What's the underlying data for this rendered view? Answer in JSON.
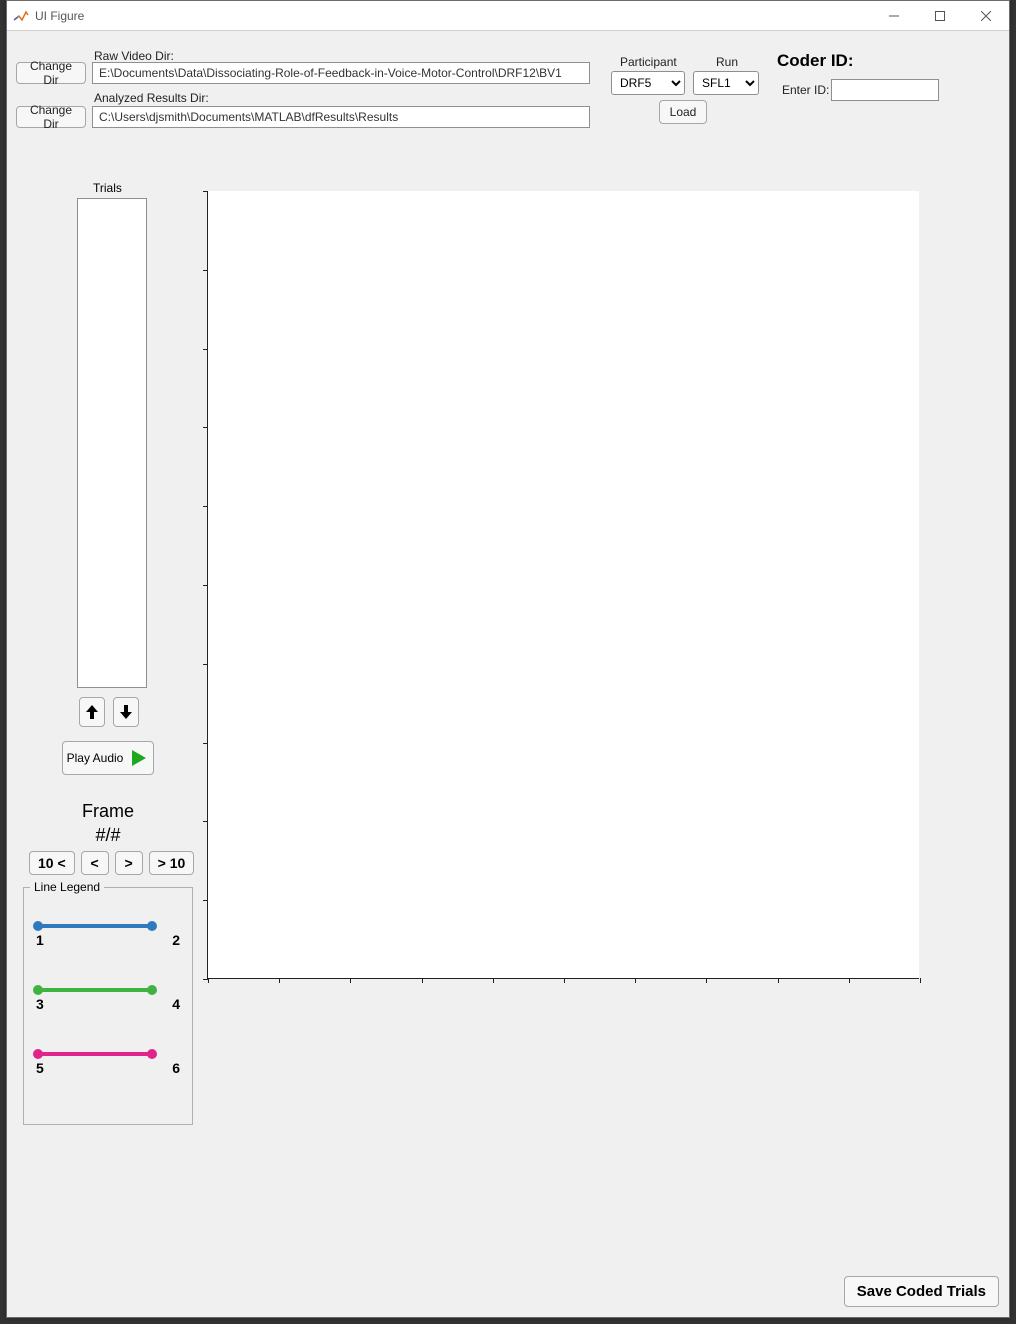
{
  "window": {
    "title": "UI Figure"
  },
  "dirs": {
    "raw_label": "Raw Video Dir:",
    "raw_value": "E:\\Documents\\Data\\Dissociating-Role-of-Feedback-in-Voice-Motor-Control\\DRF12\\BV1",
    "analyzed_label": "Analyzed Results Dir:",
    "analyzed_value": "C:\\Users\\djsmith\\Documents\\MATLAB\\dfResults\\Results",
    "change_dir_label": "Change Dir"
  },
  "participant": {
    "label": "Participant",
    "value": "DRF5"
  },
  "run": {
    "label": "Run",
    "value": "SFL1"
  },
  "load_label": "Load",
  "coder": {
    "title": "Coder ID:",
    "enter_label": "Enter ID:",
    "value": ""
  },
  "trials": {
    "label": "Trials"
  },
  "play_audio_label": "Play Audio",
  "frame": {
    "title": "Frame",
    "count": "#/#"
  },
  "nav": {
    "back10": "10 <",
    "back1": "<",
    "fwd1": ">",
    "fwd10": "> 10"
  },
  "legend": {
    "title": "Line Legend",
    "lines": [
      {
        "color": "#2f7abf",
        "left": "1",
        "right": "2"
      },
      {
        "color": "#3fb33f",
        "left": "3",
        "right": "4"
      },
      {
        "color": "#e0248c",
        "left": "5",
        "right": "6"
      }
    ]
  },
  "save_label": "Save Coded Trials",
  "chart_data": {
    "type": "line",
    "title": "",
    "xlabel": "",
    "ylabel": "",
    "x": [],
    "series": [],
    "xlim": [
      0,
      1
    ],
    "ylim": [
      0,
      1
    ],
    "x_ticks_count": 11,
    "y_ticks_count": 11
  }
}
